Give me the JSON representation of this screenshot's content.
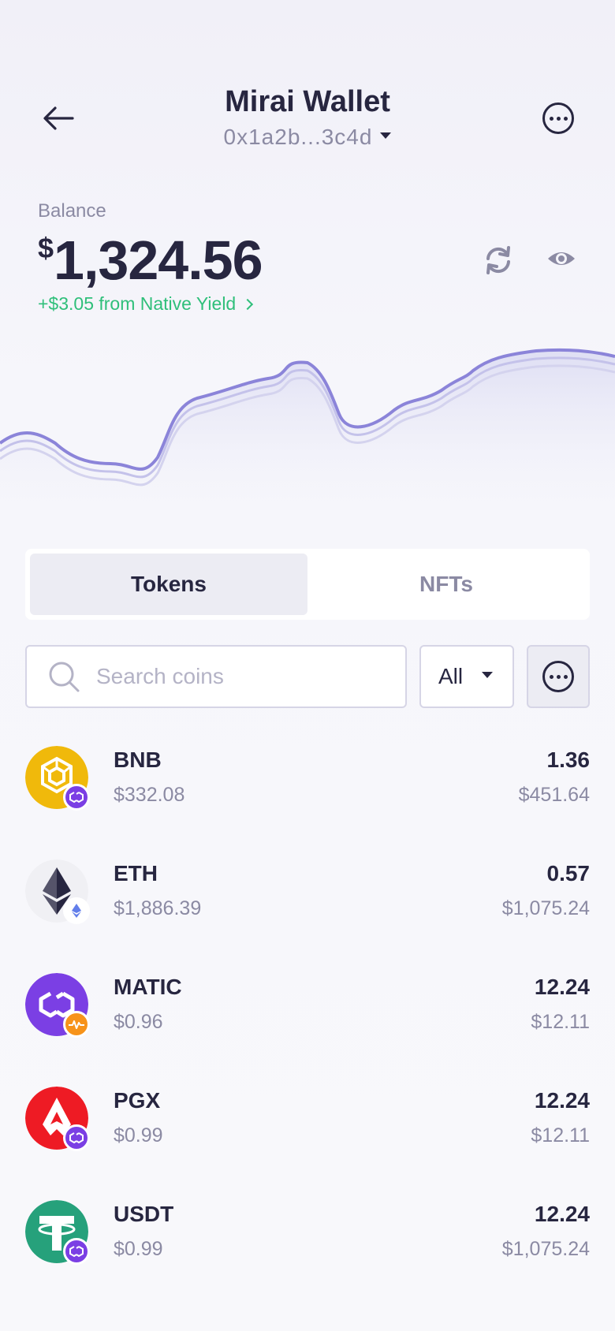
{
  "header": {
    "title": "Mirai Wallet",
    "address": "0x1a2b...3c4d"
  },
  "balance": {
    "label": "Balance",
    "currency": "$",
    "amount": "1,324.56",
    "yield_text": "+$3.05 from Native Yield"
  },
  "tabs": [
    {
      "label": "Tokens",
      "active": true
    },
    {
      "label": "NFTs",
      "active": false
    }
  ],
  "search": {
    "placeholder": "Search coins",
    "value": ""
  },
  "filter": {
    "selected": "All"
  },
  "tokens": [
    {
      "symbol": "BNB",
      "price": "$332.08",
      "quantity": "1.36",
      "value": "$451.64",
      "color": "#f0b90b",
      "badge_icon": "polygon-icon"
    },
    {
      "symbol": "ETH",
      "price": "$1,886.39",
      "quantity": "0.57",
      "value": "$1,075.24",
      "color": "#f0f0f4",
      "badge_icon": "ethereum-icon"
    },
    {
      "symbol": "MATIC",
      "price": "$0.96",
      "quantity": "12.24",
      "value": "$12.11",
      "color": "#7b3fe4",
      "badge_icon": "arbitrum-icon"
    },
    {
      "symbol": "PGX",
      "price": "$0.99",
      "quantity": "12.24",
      "value": "$12.11",
      "color": "#ee1b24",
      "badge_icon": "polygon-icon"
    },
    {
      "symbol": "USDT",
      "price": "$0.99",
      "quantity": "12.24",
      "value": "$1,075.24",
      "color": "#26a17b",
      "badge_icon": "polygon-icon"
    }
  ],
  "colors": {
    "accent": "#8b84d9",
    "positive": "#2fbf7a",
    "text": "#272640",
    "muted": "#8b8aa3"
  }
}
